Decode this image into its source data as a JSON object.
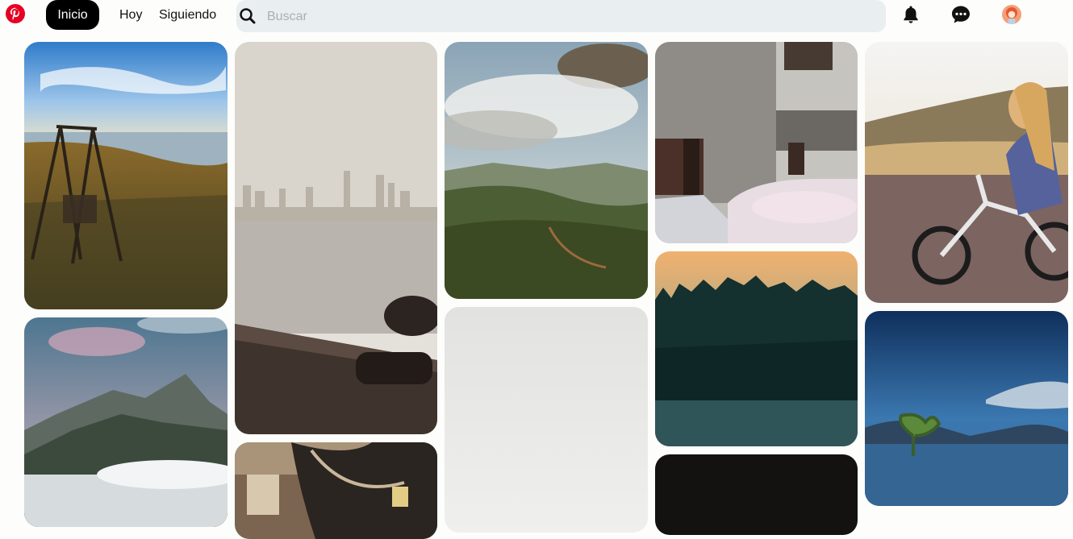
{
  "nav": {
    "home": "Inicio",
    "today": "Hoy",
    "following": "Siguiendo"
  },
  "search": {
    "placeholder": "Buscar"
  },
  "icons": {
    "logo": "pinterest-logo",
    "search": "search-icon",
    "notifications": "bell-icon",
    "messages": "chat-icon",
    "profile": "avatar"
  },
  "colors": {
    "brand": "#e60023",
    "active_tab": "#000000",
    "search_bg": "#e9eef0"
  },
  "pins": [
    {
      "id": "swing-lake"
    },
    {
      "id": "foggy-city-bay"
    },
    {
      "id": "valley-clouds"
    },
    {
      "id": "old-house-cars"
    },
    {
      "id": "girl-bicycle"
    },
    {
      "id": "mountain-fog"
    },
    {
      "id": "vintage-sewing-machine"
    },
    {
      "id": "grey-mist"
    },
    {
      "id": "forest-dusk"
    },
    {
      "id": "dark-pin"
    },
    {
      "id": "lake-tree"
    }
  ]
}
